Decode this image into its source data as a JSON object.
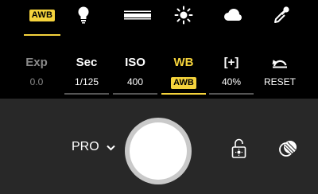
{
  "colors": {
    "accent": "#f5d33c",
    "top_background": "#000000",
    "bottom_background": "#282828",
    "inactive_bar": "#555555",
    "dim_text": "#8a8a8a"
  },
  "wb_presets": [
    {
      "icon": "awb-icon",
      "label": "AWB",
      "selected": true
    },
    {
      "icon": "bulb-icon",
      "selected": false
    },
    {
      "icon": "fluorescent-icon",
      "selected": false
    },
    {
      "icon": "sun-icon",
      "selected": false
    },
    {
      "icon": "cloud-icon",
      "selected": false
    },
    {
      "icon": "eyedropper-icon",
      "selected": false
    }
  ],
  "settings": {
    "exp": {
      "label": "Exp",
      "value": "0.0"
    },
    "sec": {
      "label": "Sec",
      "value": "1/125"
    },
    "iso": {
      "label": "ISO",
      "value": "400"
    },
    "wb": {
      "label": "WB",
      "value": "AWB"
    },
    "focus": {
      "label": "[+]",
      "value": "40%"
    },
    "reset": {
      "label": "RESET"
    }
  },
  "controls": {
    "mode_label": "PRO"
  }
}
